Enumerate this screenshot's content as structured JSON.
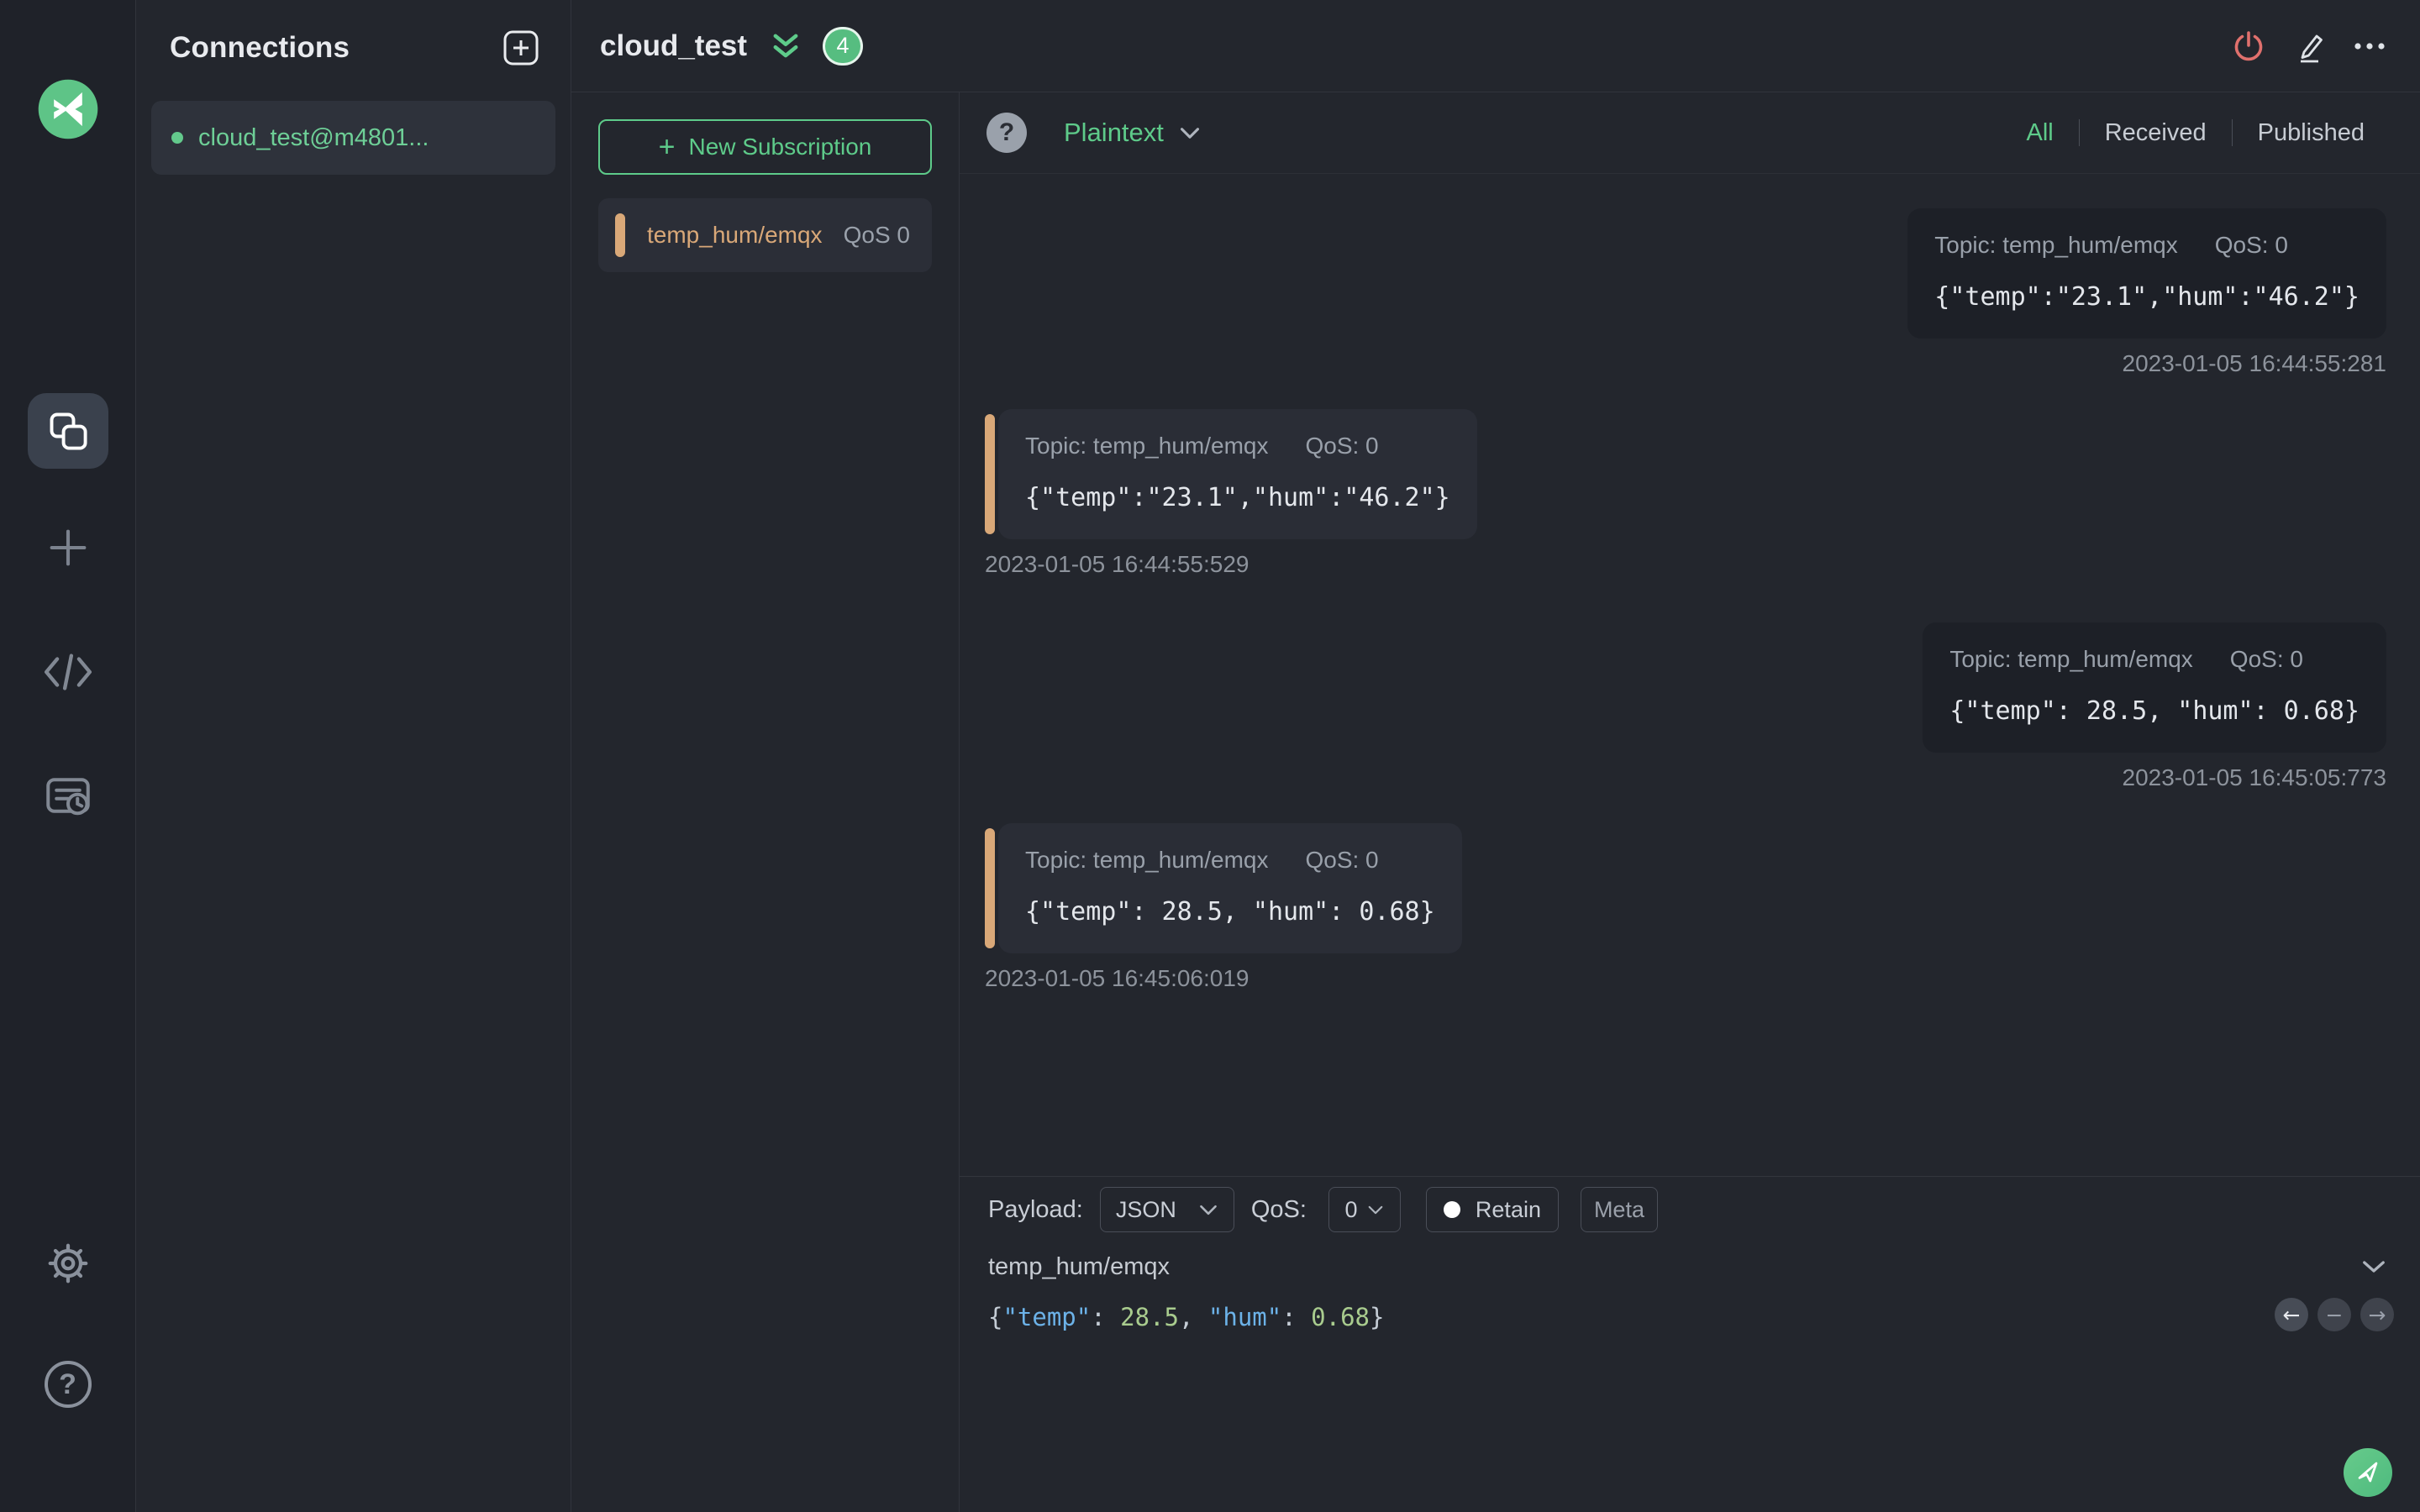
{
  "connections_panel": {
    "title": "Connections",
    "items": [
      {
        "label": "cloud_test@m4801...",
        "connected": true
      }
    ]
  },
  "header": {
    "title": "cloud_test",
    "unread_badge": "4"
  },
  "subscriptions": {
    "new_button_plus": "+",
    "new_button": "New Subscription",
    "items": [
      {
        "topic": "temp_hum/emqx",
        "qos": "QoS 0"
      }
    ]
  },
  "filter_bar": {
    "help_glyph": "?",
    "format": "Plaintext",
    "tabs": [
      {
        "label": "All",
        "active": true
      },
      {
        "label": "Received",
        "active": false
      },
      {
        "label": "Published",
        "active": false
      }
    ]
  },
  "messages": [
    {
      "type": "published",
      "topic": "Topic: temp_hum/emqx",
      "qos": "QoS: 0",
      "payload": "{\"temp\":\"23.1\",\"hum\":\"46.2\"}",
      "timestamp": "2023-01-05 16:44:55:281"
    },
    {
      "type": "received",
      "topic": "Topic: temp_hum/emqx",
      "qos": "QoS: 0",
      "payload": "{\"temp\":\"23.1\",\"hum\":\"46.2\"}",
      "timestamp": "2023-01-05 16:44:55:529"
    },
    {
      "type": "published",
      "topic": "Topic: temp_hum/emqx",
      "qos": "QoS: 0",
      "payload": "{\"temp\": 28.5, \"hum\": 0.68}",
      "timestamp": "2023-01-05 16:45:05:773"
    },
    {
      "type": "received",
      "topic": "Topic: temp_hum/emqx",
      "qos": "QoS: 0",
      "payload": "{\"temp\": 28.5, \"hum\": 0.68}",
      "timestamp": "2023-01-05 16:45:06:019"
    }
  ],
  "publish": {
    "payload_label": "Payload:",
    "format_value": "JSON",
    "qos_label": "QoS:",
    "qos_value": "0",
    "retain_label": "Retain",
    "meta_label": "Meta",
    "topic_value": "temp_hum/emqx",
    "history": {
      "prev": "←",
      "clear": "−",
      "next": "→"
    },
    "editor": {
      "t0": "{",
      "t1": "\"temp\"",
      "t2": ": ",
      "t3": "28.5",
      "t4": ", ",
      "t5": "\"hum\"",
      "t6": ": ",
      "t7": "0.68",
      "t8": "}"
    }
  },
  "colors": {
    "accent_green": "#5ecb8a",
    "accent_orange": "#d9a878",
    "badge_green": "#56bd80",
    "danger_red": "#e0706d"
  }
}
